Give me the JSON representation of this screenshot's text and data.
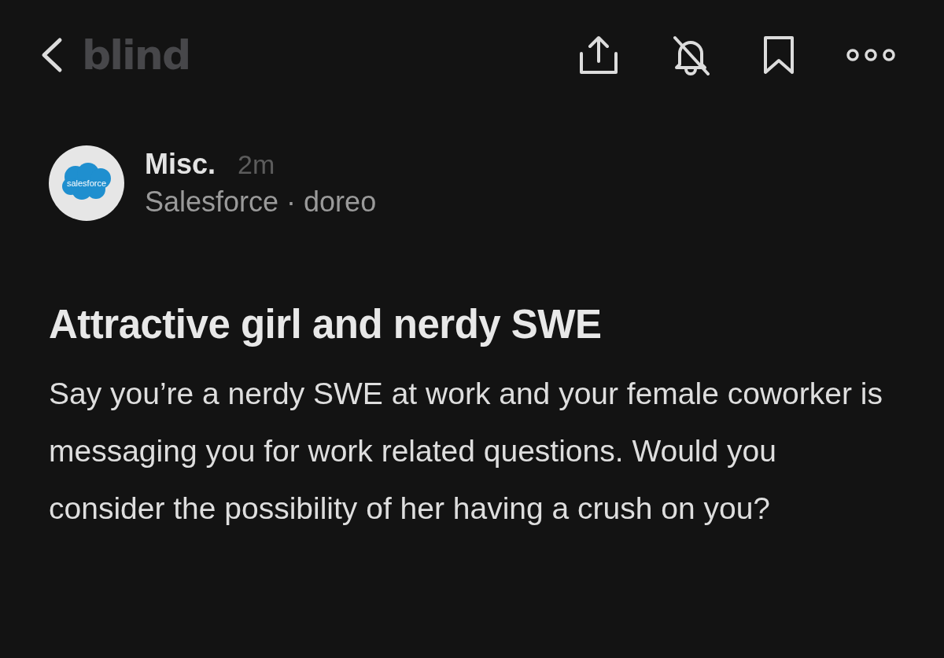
{
  "top_bar": {
    "logo": "blind",
    "actions": [
      {
        "kind": "share"
      },
      {
        "kind": "mute"
      },
      {
        "kind": "bookmark"
      },
      {
        "kind": "more"
      }
    ]
  },
  "post": {
    "avatar": {
      "logo_text": "salesforce"
    },
    "channel": "Misc.",
    "time": "2m",
    "author": "Salesforce · doreo",
    "title": "Attractive girl and nerdy SWE",
    "body": "Say you’re a nerdy SWE at work and your female coworker is messaging you for work related questions. Would you consider the possibility of her having a crush on you?"
  }
}
